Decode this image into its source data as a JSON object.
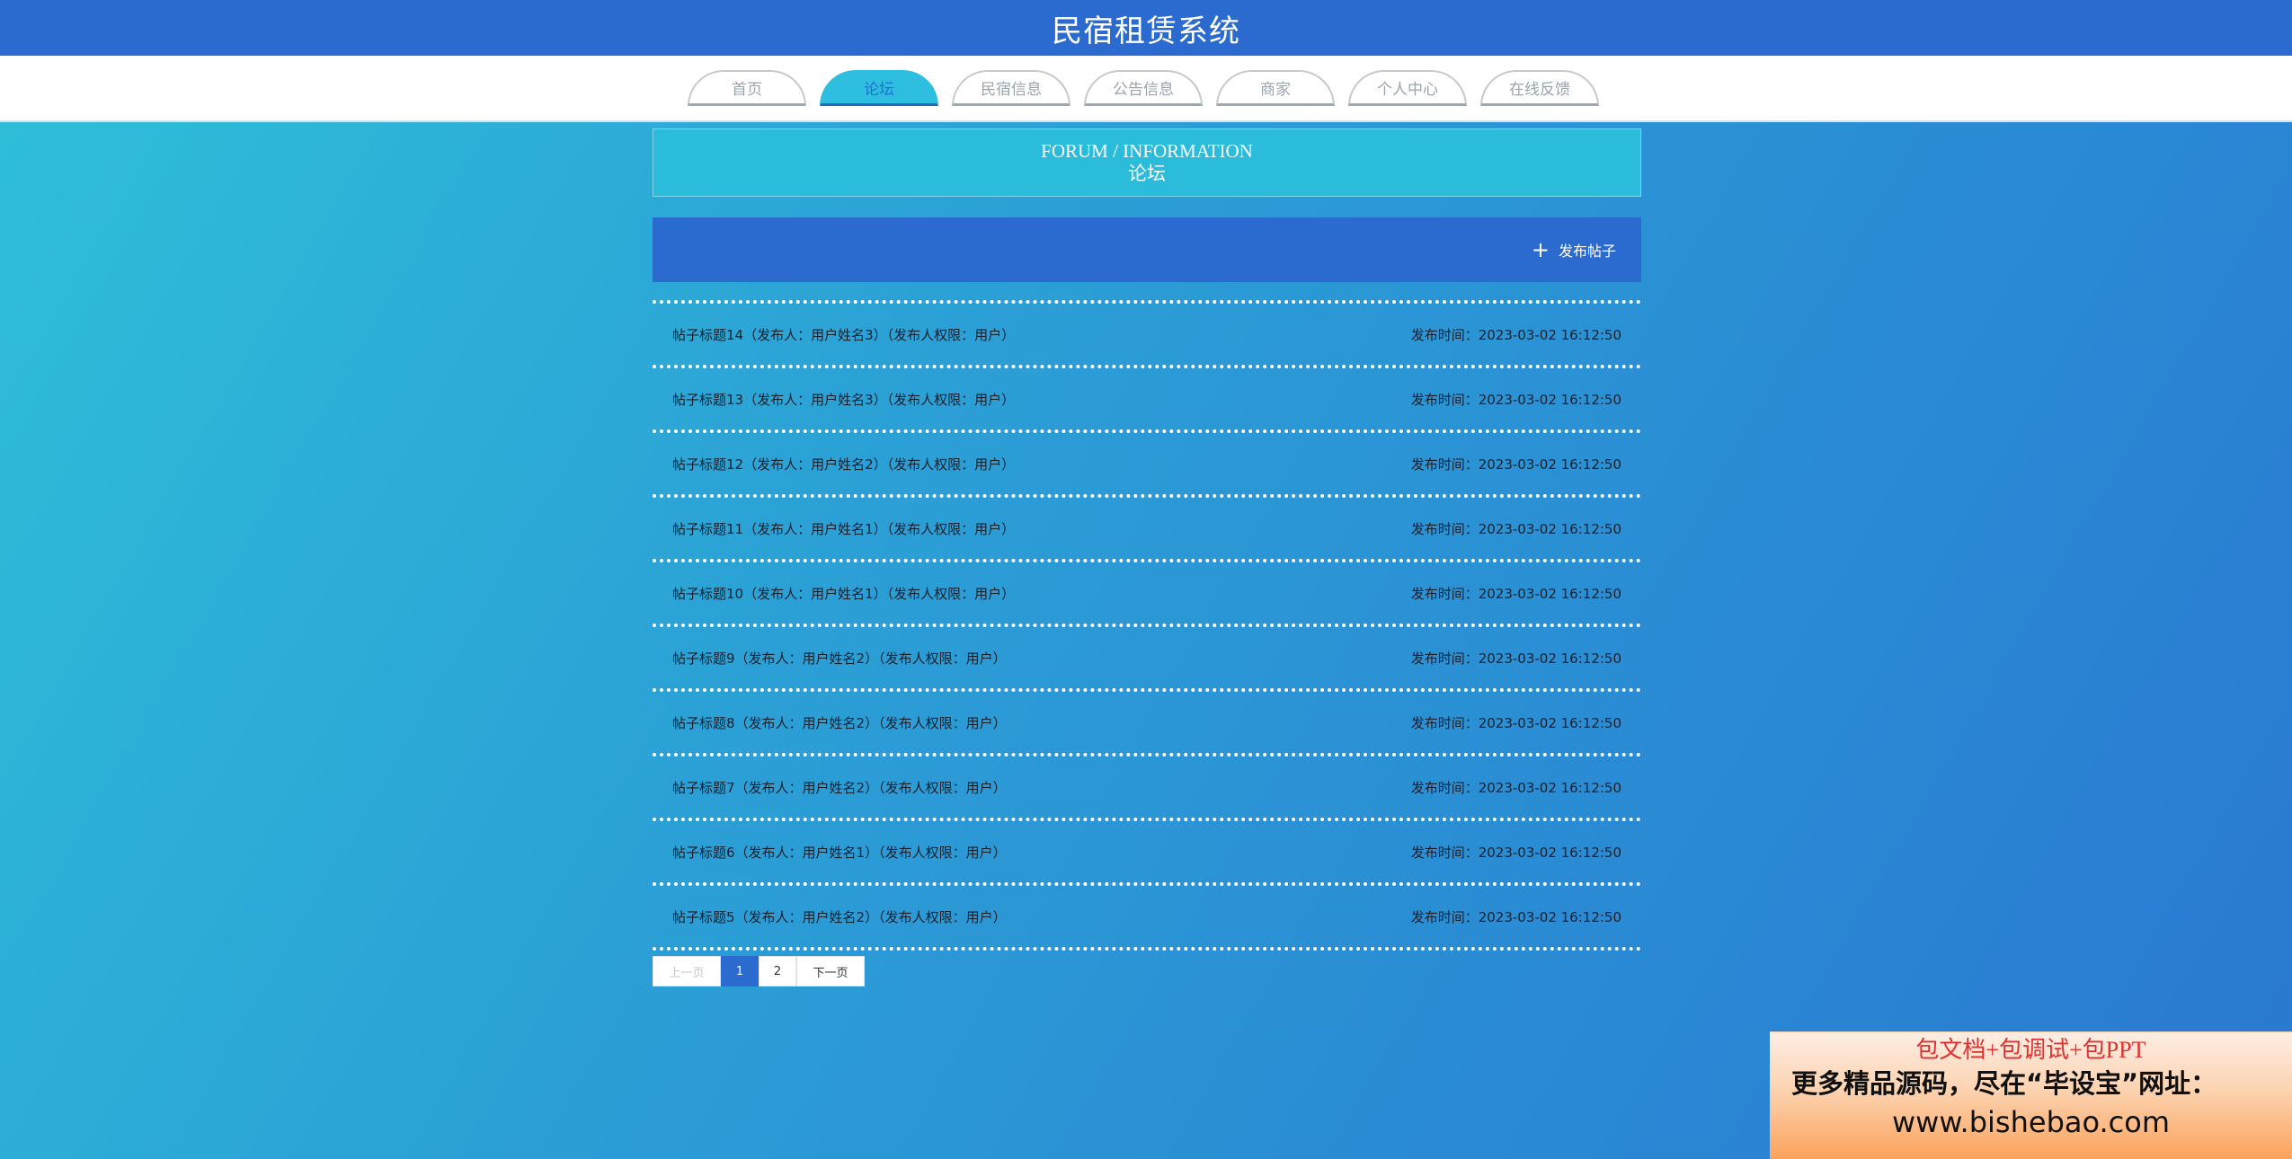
{
  "app": {
    "title": "民宿租赁系统"
  },
  "nav": {
    "items": [
      {
        "label": "首页"
      },
      {
        "label": "论坛"
      },
      {
        "label": "民宿信息"
      },
      {
        "label": "公告信息"
      },
      {
        "label": "商家"
      },
      {
        "label": "个人中心"
      },
      {
        "label": "在线反馈"
      }
    ],
    "active": "论坛"
  },
  "panel": {
    "title_en": "FORUM / INFORMATION",
    "title_cn": "论坛"
  },
  "actions": {
    "post_label": "发布帖子",
    "post_icon": "plus-icon"
  },
  "posts": [
    {
      "title": "帖子标题14（发布人：用户姓名3）（发布人权限：用户）",
      "time": "发布时间：2023-03-02 16:12:50"
    },
    {
      "title": "帖子标题13（发布人：用户姓名3）（发布人权限：用户）",
      "time": "发布时间：2023-03-02 16:12:50"
    },
    {
      "title": "帖子标题12（发布人：用户姓名2）（发布人权限：用户）",
      "time": "发布时间：2023-03-02 16:12:50"
    },
    {
      "title": "帖子标题11（发布人：用户姓名1）（发布人权限：用户）",
      "time": "发布时间：2023-03-02 16:12:50"
    },
    {
      "title": "帖子标题10（发布人：用户姓名1）（发布人权限：用户）",
      "time": "发布时间：2023-03-02 16:12:50"
    },
    {
      "title": "帖子标题9（发布人：用户姓名2）（发布人权限：用户）",
      "time": "发布时间：2023-03-02 16:12:50"
    },
    {
      "title": "帖子标题8（发布人：用户姓名2）（发布人权限：用户）",
      "time": "发布时间：2023-03-02 16:12:50"
    },
    {
      "title": "帖子标题7（发布人：用户姓名2）（发布人权限：用户）",
      "time": "发布时间：2023-03-02 16:12:50"
    },
    {
      "title": "帖子标题6（发布人：用户姓名1）（发布人权限：用户）",
      "time": "发布时间：2023-03-02 16:12:50"
    },
    {
      "title": "帖子标题5（发布人：用户姓名2）（发布人权限：用户）",
      "time": "发布时间：2023-03-02 16:12:50"
    }
  ],
  "pagination": {
    "prev_label": "上一页",
    "pages": [
      "1",
      "2"
    ],
    "current": "1",
    "next_label": "下一页"
  },
  "ad": {
    "line1": "包文档+包调试+包PPT",
    "line2": "更多精品源码，尽在“毕设宝”网址：",
    "line3": "www.bishebao.com"
  },
  "colors": {
    "header_bg": "#2b6bd0",
    "accent_cyan": "#2bbcdb",
    "page_bg_start": "#2ec0d8",
    "page_bg_end": "#2a78d2"
  }
}
